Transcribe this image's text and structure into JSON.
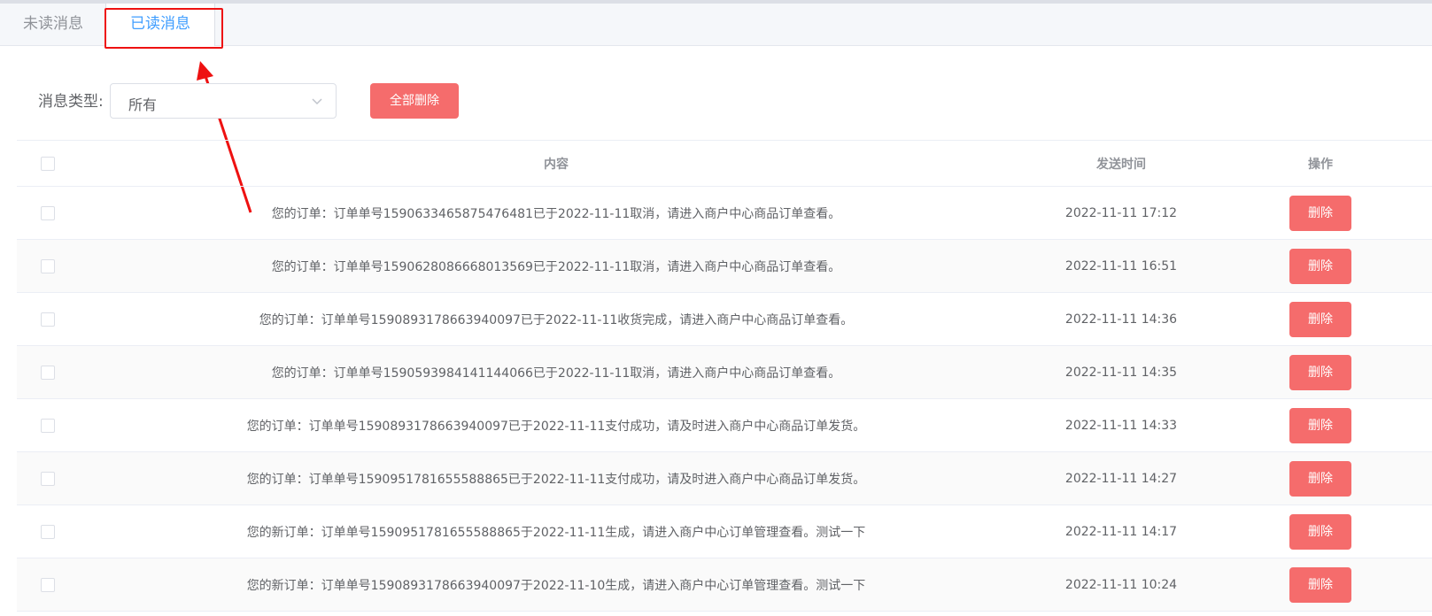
{
  "tabs": {
    "unread": "未读消息",
    "read": "已读消息"
  },
  "filter": {
    "label": "消息类型:",
    "selected": "所有",
    "delete_all": "全部删除"
  },
  "table": {
    "headers": {
      "content": "内容",
      "time": "发送时间",
      "action": "操作"
    },
    "delete_label": "删除",
    "rows": [
      {
        "content": "您的订单：订单单号1590633465875476481已于2022-11-11取消，请进入商户中心商品订单查看。",
        "time": "2022-11-11 17:12"
      },
      {
        "content": "您的订单：订单单号1590628086668013569已于2022-11-11取消，请进入商户中心商品订单查看。",
        "time": "2022-11-11 16:51"
      },
      {
        "content": "您的订单：订单单号1590893178663940097已于2022-11-11收货完成，请进入商户中心商品订单查看。",
        "time": "2022-11-11 14:36"
      },
      {
        "content": "您的订单：订单单号1590593984141144066已于2022-11-11取消，请进入商户中心商品订单查看。",
        "time": "2022-11-11 14:35"
      },
      {
        "content": "您的订单：订单单号1590893178663940097已于2022-11-11支付成功，请及时进入商户中心商品订单发货。",
        "time": "2022-11-11 14:33"
      },
      {
        "content": "您的订单：订单单号1590951781655588865已于2022-11-11支付成功，请及时进入商户中心商品订单发货。",
        "time": "2022-11-11 14:27"
      },
      {
        "content": "您的新订单：订单单号1590951781655588865于2022-11-11生成，请进入商户中心订单管理查看。测试一下",
        "time": "2022-11-11 14:17"
      },
      {
        "content": "您的新订单：订单单号1590893178663940097于2022-11-10生成，请进入商户中心订单管理查看。测试一下",
        "time": "2022-11-11 10:24"
      }
    ]
  },
  "colors": {
    "active_tab": "#409eff",
    "danger": "#f56c6c",
    "annotation": "#ee1111"
  }
}
